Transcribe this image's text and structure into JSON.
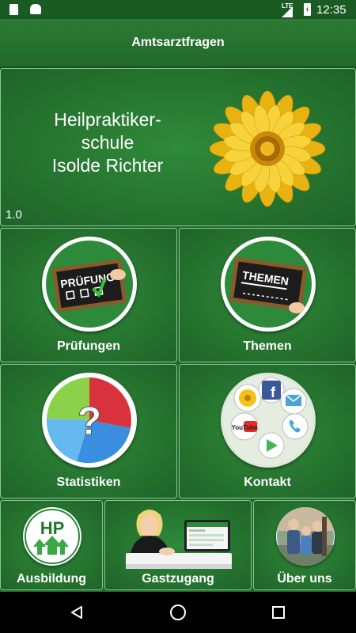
{
  "status_bar": {
    "network": "LTE",
    "time": "12:35"
  },
  "app_bar": {
    "title": "Amtsarztfragen"
  },
  "banner": {
    "school_lines": [
      "Heilpraktiker-",
      "schule",
      "Isolde Richter"
    ],
    "version": "1.0",
    "flower_icon": "sunflower-icon"
  },
  "tiles": {
    "pruefungen": {
      "label": "Prüfungen",
      "board_text": "PRÜFUNG"
    },
    "themen": {
      "label": "Themen",
      "board_text": "THEMEN"
    },
    "statistiken": {
      "label": "Statistiken",
      "question_mark": "?"
    },
    "kontakt": {
      "label": "Kontakt",
      "youtube_text": "YouTube"
    },
    "ausbildung": {
      "label": "Ausbildung",
      "logo_text": "HP"
    },
    "gastzugang": {
      "label": "Gastzugang"
    },
    "ueber_uns": {
      "label": "Über uns"
    }
  },
  "colors": {
    "background": "#1e6a2c",
    "tile": "#2f8a3a",
    "tile_border": "#8ec48f",
    "flower_petal": "#f2c318",
    "facebook": "#3b5998",
    "youtube_red": "#e52d27"
  }
}
